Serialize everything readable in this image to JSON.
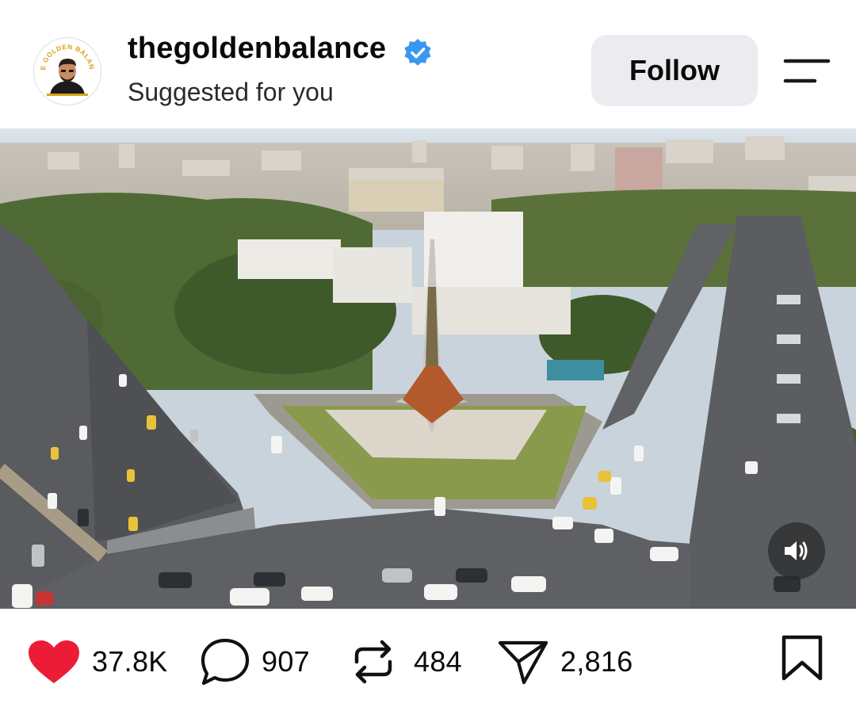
{
  "post": {
    "username": "thegoldenbalance",
    "subtitle": "Suggested for you",
    "follow_label": "Follow",
    "avatar_text": "THE GOLDEN BALANCE"
  },
  "colors": {
    "verified": "#3897f0",
    "like": "#ed1c36",
    "button_bg": "#ececf0"
  },
  "media": {
    "type": "video",
    "sound_icon": "speaker-volume-icon"
  },
  "actions": {
    "likes": "37.8K",
    "comments": "907",
    "reposts": "484",
    "shares": "2,816"
  }
}
